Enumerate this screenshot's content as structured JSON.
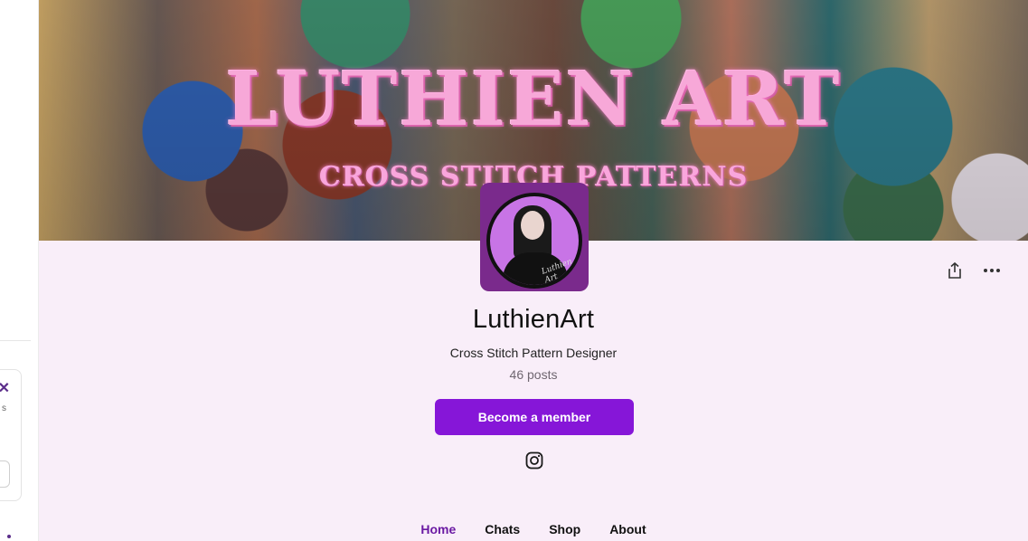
{
  "banner": {
    "title": "LUTHIEN ART",
    "subtitle": "CROSS STITCH PATTERNS"
  },
  "avatar": {
    "signature": "Luthien Art"
  },
  "profile": {
    "name": "LuthienArt",
    "tagline": "Cross Stitch Pattern Designer",
    "posts": "46 posts",
    "member_button": "Become a member"
  },
  "icons": {
    "share": "share-icon",
    "more": "more-icon",
    "instagram": "instagram-icon"
  },
  "tabs": [
    {
      "label": "Home",
      "active": true
    },
    {
      "label": "Chats",
      "active": false
    },
    {
      "label": "Shop",
      "active": false
    },
    {
      "label": "About",
      "active": false
    }
  ],
  "colors": {
    "accent": "#8616d8",
    "active_tab": "#6b1aa3",
    "page_bg": "#f9eef9"
  }
}
